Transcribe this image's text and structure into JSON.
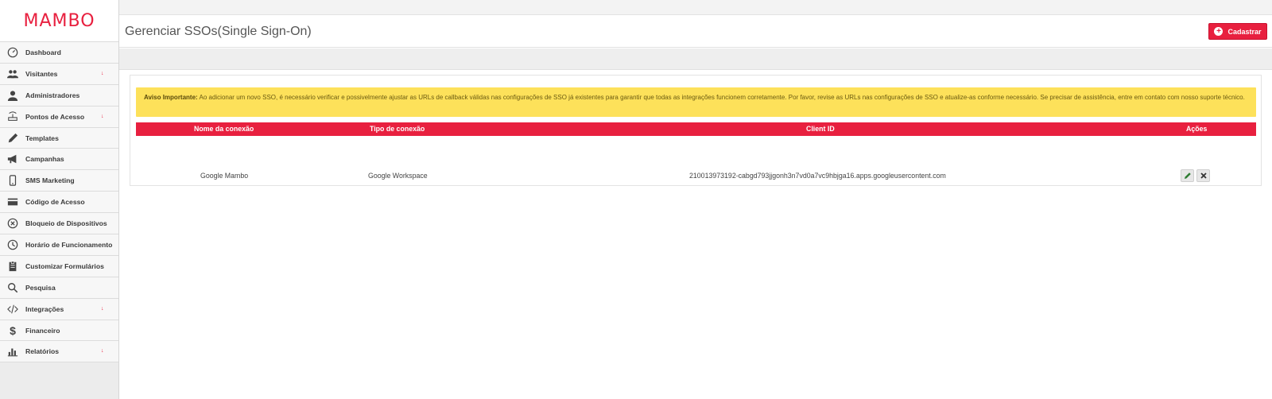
{
  "app": {
    "logo": "MAMBO"
  },
  "sidebar": {
    "items": [
      {
        "label": "Dashboard",
        "icon": "dashboard-icon",
        "caret": false
      },
      {
        "label": "Visitantes",
        "icon": "users-icon",
        "caret": true
      },
      {
        "label": "Administradores",
        "icon": "user-icon",
        "caret": false
      },
      {
        "label": "Pontos de Acesso",
        "icon": "access-point-icon",
        "caret": true
      },
      {
        "label": "Templates",
        "icon": "pencil-icon",
        "caret": false
      },
      {
        "label": "Campanhas",
        "icon": "megaphone-icon",
        "caret": false
      },
      {
        "label": "SMS Marketing",
        "icon": "mobile-icon",
        "caret": false
      },
      {
        "label": "Código de Acesso",
        "icon": "card-icon",
        "caret": false
      },
      {
        "label": "Bloqueio de Dispositivos",
        "icon": "block-icon",
        "caret": false
      },
      {
        "label": "Horário de Funcionamento",
        "icon": "clock-icon",
        "caret": false
      },
      {
        "label": "Customizar Formulários",
        "icon": "clipboard-icon",
        "caret": false
      },
      {
        "label": "Pesquisa",
        "icon": "search-icon",
        "caret": false
      },
      {
        "label": "Integrações",
        "icon": "code-icon",
        "caret": true
      },
      {
        "label": "Financeiro",
        "icon": "dollar-icon",
        "caret": false
      },
      {
        "label": "Relatórios",
        "icon": "bar-chart-icon",
        "caret": true
      }
    ]
  },
  "header": {
    "title": "Gerenciar SSOs(Single Sign-On)",
    "add_button": "Cadastrar"
  },
  "alert": {
    "title": "Aviso Importante:",
    "text": " Ao adicionar um novo SSO, é necessário verificar e possivelmente ajustar as URLs de callback válidas nas configurações de SSO já existentes para garantir que todas as integrações funcionem corretamente. Por favor, revise as URLs nas configurações de SSO e atualize-as conforme necessário. Se precisar de assistência, entre em contato com nosso suporte técnico."
  },
  "table": {
    "headers": {
      "name": "Nome da conexão",
      "type": "Tipo de conexão",
      "client_id": "Client ID",
      "actions": "Ações"
    },
    "rows": [
      {
        "name": "Google Mambo",
        "type": "Google Workspace",
        "client_id": "210013973192-cabgd793jjgonh3n7vd0a7vc9hbjga16.apps.googleusercontent.com"
      }
    ]
  },
  "colors": {
    "accent": "#e8203f",
    "alert": "#fde15a"
  }
}
